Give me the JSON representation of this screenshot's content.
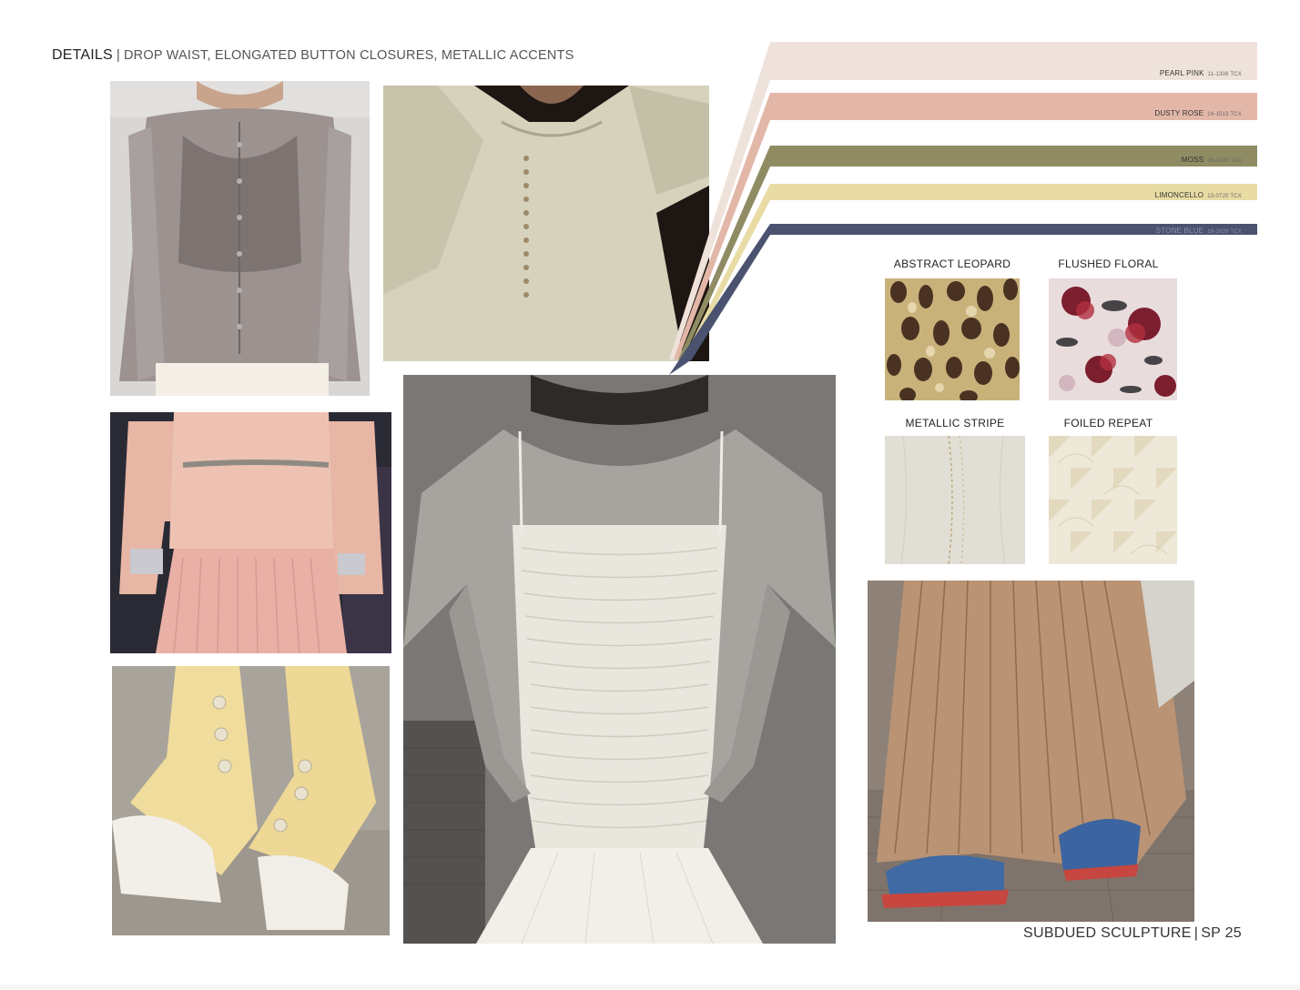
{
  "header": {
    "lead": "DETAILS",
    "separator": "|",
    "rest": "DROP WAIST, ELONGATED BUTTON CLOSURES, METALLIC ACCENTS"
  },
  "palette": [
    {
      "name": "PEARL PINK",
      "code": "11-1306 TCX",
      "color": "#efe2da"
    },
    {
      "name": "DUSTY ROSE",
      "code": "14-1513 TCX",
      "color": "#e2b7a8"
    },
    {
      "name": "MOSS",
      "code": "16-0430 TCX",
      "color": "#8f8c64"
    },
    {
      "name": "LIMONCELLO",
      "code": "13-0720 TCX",
      "color": "#e8dca4"
    },
    {
      "name": "STONE BLUE",
      "code": "18-3928 TCX",
      "color": "#4a5270"
    }
  ],
  "prints": [
    {
      "title": "ABSTRACT LEOPARD"
    },
    {
      "title": "FLUSHED FLORAL"
    },
    {
      "title": "METALLIC STRIPE"
    },
    {
      "title": "FOILED REPEAT"
    }
  ],
  "photos": {
    "sheer_cardigan": "sheer-cardigan-photo",
    "button_blouse": "button-blouse-photo",
    "pink_pleat": "pink-pleat-photo",
    "yellow_trousers": "yellow-trousers-photo",
    "ruched_dress": "ruched-dress-photo",
    "pleated_skirt": "pleated-skirt-photo"
  },
  "footer": {
    "title": "SUBDUED SCULPTURE",
    "separator": "|",
    "season": "SP 25"
  }
}
